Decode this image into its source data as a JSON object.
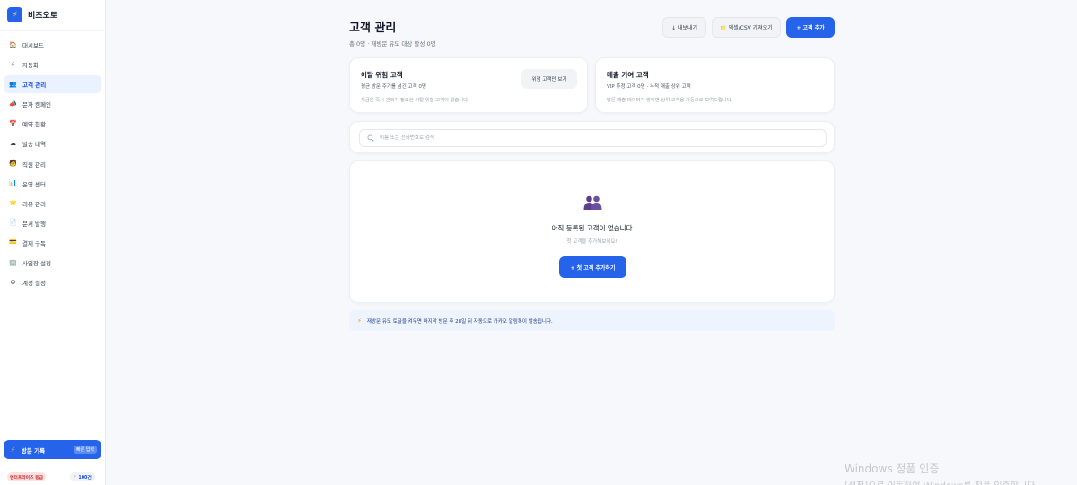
{
  "brand": {
    "name": "비즈오토",
    "logo_icon": "bolt-icon"
  },
  "sidebar": {
    "items": [
      {
        "label": "대시보드",
        "icon": "home-icon",
        "glyph": "🏠",
        "active": false
      },
      {
        "label": "자동화",
        "icon": "bolt-icon",
        "glyph": "⚡",
        "active": false
      },
      {
        "label": "고객 관리",
        "icon": "users-icon",
        "glyph": "👥",
        "active": true
      },
      {
        "label": "문자 캠페인",
        "icon": "megaphone-icon",
        "glyph": "📣",
        "active": false
      },
      {
        "label": "예약 현황",
        "icon": "calendar-icon",
        "glyph": "📅",
        "active": false
      },
      {
        "label": "발송 내역",
        "icon": "cloud-icon",
        "glyph": "☁",
        "active": false
      },
      {
        "label": "직원 관리",
        "icon": "staff-icon",
        "glyph": "🧑",
        "active": false
      },
      {
        "label": "운영 센터",
        "icon": "chart-icon",
        "glyph": "📊",
        "active": false
      },
      {
        "label": "리뷰 관리",
        "icon": "star-icon",
        "glyph": "⭐",
        "active": false
      },
      {
        "label": "문서 발행",
        "icon": "document-icon",
        "glyph": "📄",
        "active": false
      },
      {
        "label": "결제 구독",
        "icon": "card-icon",
        "glyph": "💳",
        "active": false
      },
      {
        "label": "사업장 설정",
        "icon": "building-icon",
        "glyph": "🏢",
        "active": false
      },
      {
        "label": "계정 설정",
        "icon": "gear-icon",
        "glyph": "⚙",
        "active": false
      }
    ],
    "visit_button": {
      "label": "방문 기록",
      "quick": "빠른 입력"
    },
    "plan_badge": "엔터프라이즈 등급",
    "credits": "100건"
  },
  "header": {
    "title": "고객 관리",
    "subtitle": "총 0명 · 재방문 유도 대상 활성 0명",
    "export_label": "↓ 내보내기",
    "import_label": "📁 엑셀/CSV 가져오기",
    "add_label": "+ 고객 추가"
  },
  "churn_card": {
    "title": "이탈 위험 고객",
    "subtitle": "평균 방문 주기를 넘긴 고객 0명",
    "note": "지금은 즉시 관리가 필요한 이탈 위험 고객이 없습니다.",
    "button": "위험 고객만 보기"
  },
  "vip_card": {
    "title": "매출 기여 고객",
    "subtitle": "VIP 추정 고객 0명 · 누적 매출 상위 고객",
    "note": "방문·매출 데이터가 쌓이면 상위 고객을 자동으로 보여드립니다."
  },
  "search": {
    "placeholder": "이름 또는 전화번호로 검색",
    "value": ""
  },
  "empty_state": {
    "title": "아직 등록된 고객이 없습니다",
    "subtitle": "첫 고객을 추가해보세요!",
    "button": "+ 첫 고객 추가하기",
    "icon": "users-icon"
  },
  "tip": {
    "text": "재방문 유도 토글을 켜두면 마지막 방문 후 28일 뒤 자동으로 카카오 알림톡이 발송됩니다."
  },
  "watermark": {
    "line1": "Windows 정품 인증",
    "line2": "[설정]으로 이동하여 Windows를 정품 인증합니다."
  },
  "colors": {
    "accent": "#2563eb",
    "active_bg": "#eaf1ff",
    "tip_bg": "#eef4fd",
    "badge_red": "#c81e1e",
    "empty_icon": "#5b3e8e"
  }
}
